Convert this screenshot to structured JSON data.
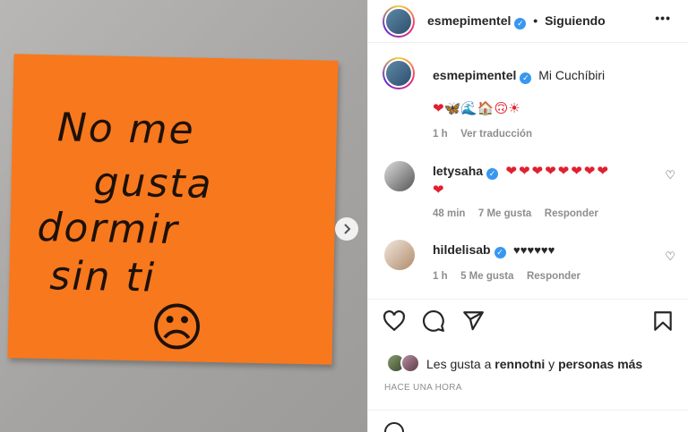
{
  "post": {
    "note_lines": [
      "No me",
      "gusta",
      "dormir",
      "sin ti"
    ],
    "note_face": "☹"
  },
  "header": {
    "username": "esmepimentel",
    "follow_status": "Siguiendo",
    "more": "•••"
  },
  "caption": {
    "username": "esmepimentel",
    "text": "Mi Cuchíbiri",
    "emojis": "❤🦋🌊🏠🙃☀",
    "time": "1 h",
    "translate": "Ver traducción"
  },
  "comments": [
    {
      "username": "letysaha",
      "hearts_line1": "❤❤❤❤❤❤❤❤",
      "hearts_line2": "❤",
      "time": "48 min",
      "likes": "7 Me gusta",
      "reply": "Responder"
    },
    {
      "username": "hildelisab",
      "text": "♥♥♥♥♥♥",
      "time": "1 h",
      "likes": "5 Me gusta",
      "reply": "Responder"
    }
  ],
  "likes_line": {
    "prefix": "Les gusta a",
    "user": "rennotni",
    "connector": "y",
    "others": "personas más"
  },
  "timestamp": "HACE UNA HORA",
  "icons": {
    "like": "heart-icon",
    "comment": "comment-icon",
    "share": "share-icon",
    "save": "bookmark-icon"
  }
}
